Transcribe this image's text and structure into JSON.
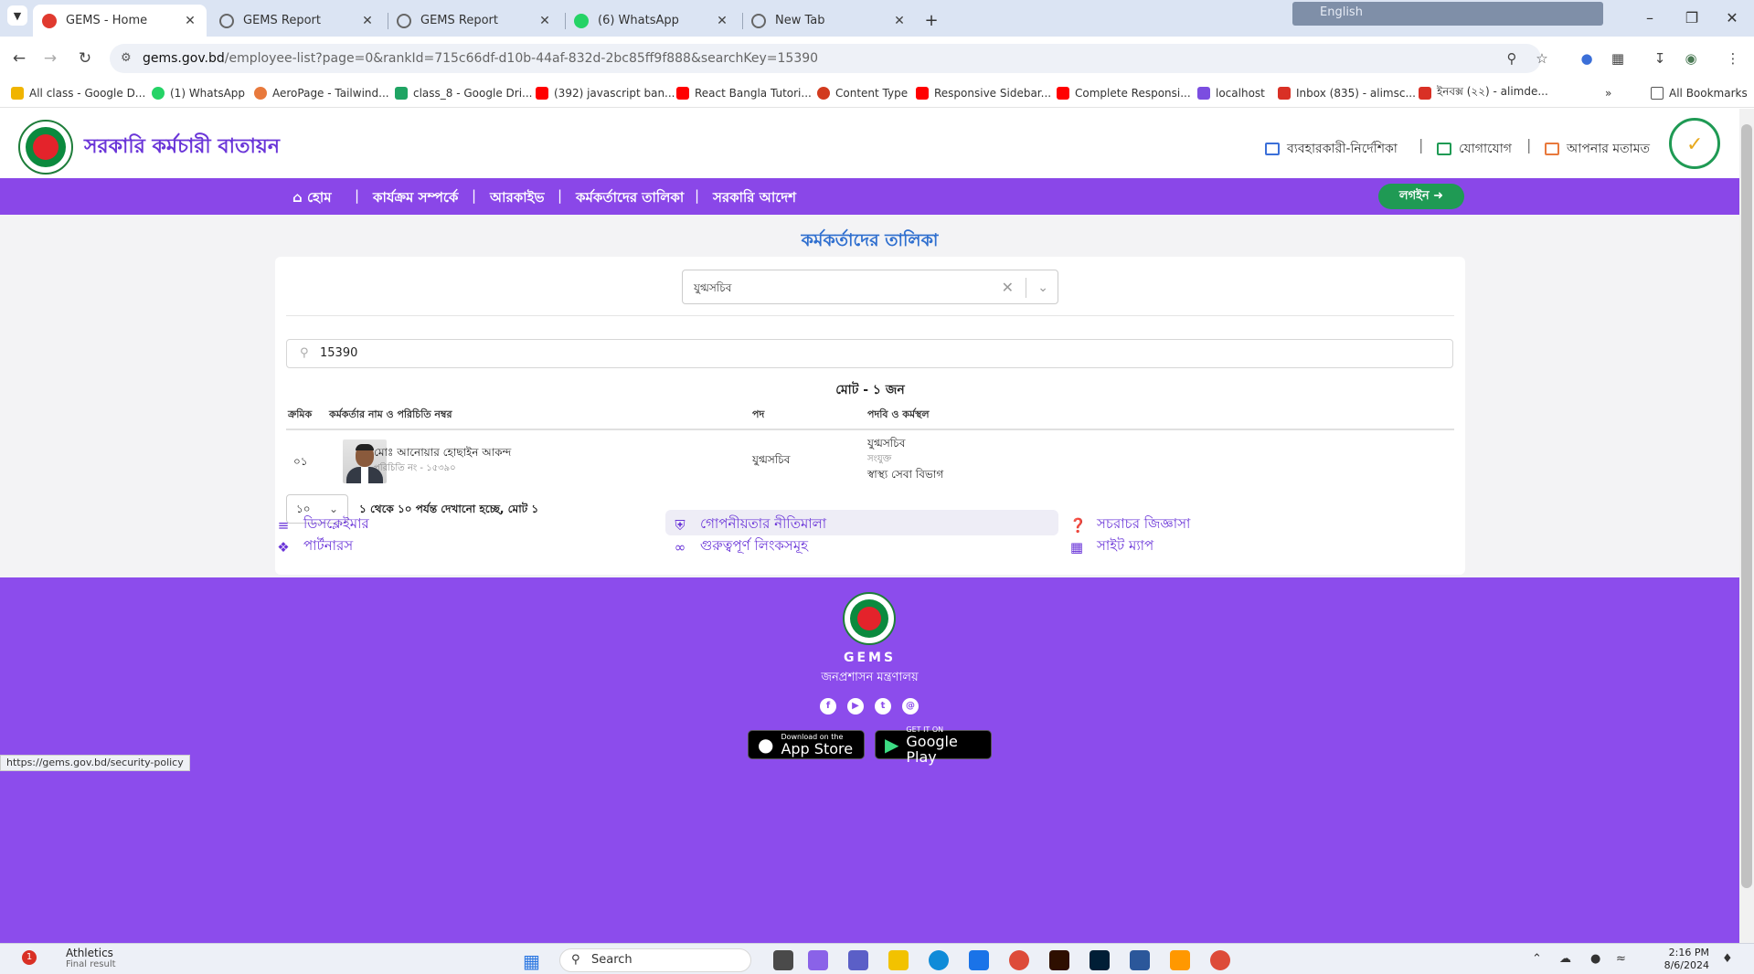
{
  "browser": {
    "tabs": [
      {
        "title": "GEMS - Home",
        "active": true
      },
      {
        "title": "GEMS Report",
        "active": false
      },
      {
        "title": "GEMS Report",
        "active": false
      },
      {
        "title": "(6) WhatsApp",
        "active": false
      },
      {
        "title": "New Tab",
        "active": false
      }
    ],
    "new_tab": "+",
    "translate": "English",
    "url_host": "gems.gov.bd",
    "url_rest": "/employee-list?page=0&rankId=715c66df-d10b-44af-832d-2bc85ff9f888&searchKey=15390",
    "bookmarks": [
      "All class - Google D...",
      "(1) WhatsApp",
      "AeroPage - Tailwind...",
      "class_8 - Google Dri...",
      "(392) javascript ban...",
      "React Bangla Tutori...",
      "Content Type",
      "Responsive Sidebar...",
      "Complete Responsi...",
      "localhost",
      "Inbox (835) - alimsc...",
      "ইনবক্স (২২) - alimde..."
    ],
    "all_bookmarks": "All Bookmarks",
    "status_url": "https://gems.gov.bd/security-policy"
  },
  "site": {
    "title": "সরকারি কর্মচারী বাতায়ন",
    "header_links": [
      "ব্যবহারকারী-নির্দেশিকা",
      "যোগাযোগ",
      "আপনার মতামত"
    ],
    "nav": [
      "হোম",
      "কার্যক্রম সম্পর্কে",
      "আরকাইভ",
      "কর্মকর্তাদের তালিকা",
      "সরকারি আদেশ"
    ],
    "login": "লগইন"
  },
  "page": {
    "title": "কর্মকর্তাদের তালিকা",
    "rank_selected": "যুগ্মসচিব",
    "search_value": "15390",
    "total": "মোট - ১ জন",
    "columns": [
      "ক্রমিক",
      "কর্মকর্তার নাম ও পরিচিতি নম্বর",
      "পদ",
      "পদবি ও কর্মস্থল"
    ],
    "rows": [
      {
        "serial": "০১",
        "name": "মোঃ আনোয়ার হোছাইন আকন্দ",
        "id": "পরিচিতি নং - ১৫৩৯০",
        "designation": "যুগ্মসচিব",
        "post": "যুগ্মসচিব",
        "post_sub": "সংযুক্ত",
        "office": "স্বাস্থ্য সেবা বিভাগ"
      }
    ],
    "page_size": "১০",
    "page_info": "১ থেকে ১০ পর্যন্ত দেখানো হচ্ছে, মোট ১"
  },
  "footer": {
    "links": [
      "ডিসক্লেইমার",
      "পার্টনারস",
      "গোপনীয়তার নীতিমালা",
      "গুরুত্বপূর্ণ লিংকসমূহ",
      "সচরাচর জিজ্ঞাসা",
      "সাইট ম্যাপ"
    ],
    "brand": "GEMS",
    "ministry": "জনপ্রশাসন মন্ত্রণালয়",
    "appstore_small": "Download on the",
    "appstore": "App Store",
    "play_small": "GET IT ON",
    "play": "Google Play"
  },
  "taskbar": {
    "weather": "Athletics",
    "weather_sub": "Final result",
    "badge": "1",
    "search": "Search",
    "time": "2:16 PM",
    "date": "8/6/2024"
  },
  "colors": {
    "purple": "#8a47e8",
    "green": "#1f9a54",
    "title_blue": "#2f6fcf"
  }
}
